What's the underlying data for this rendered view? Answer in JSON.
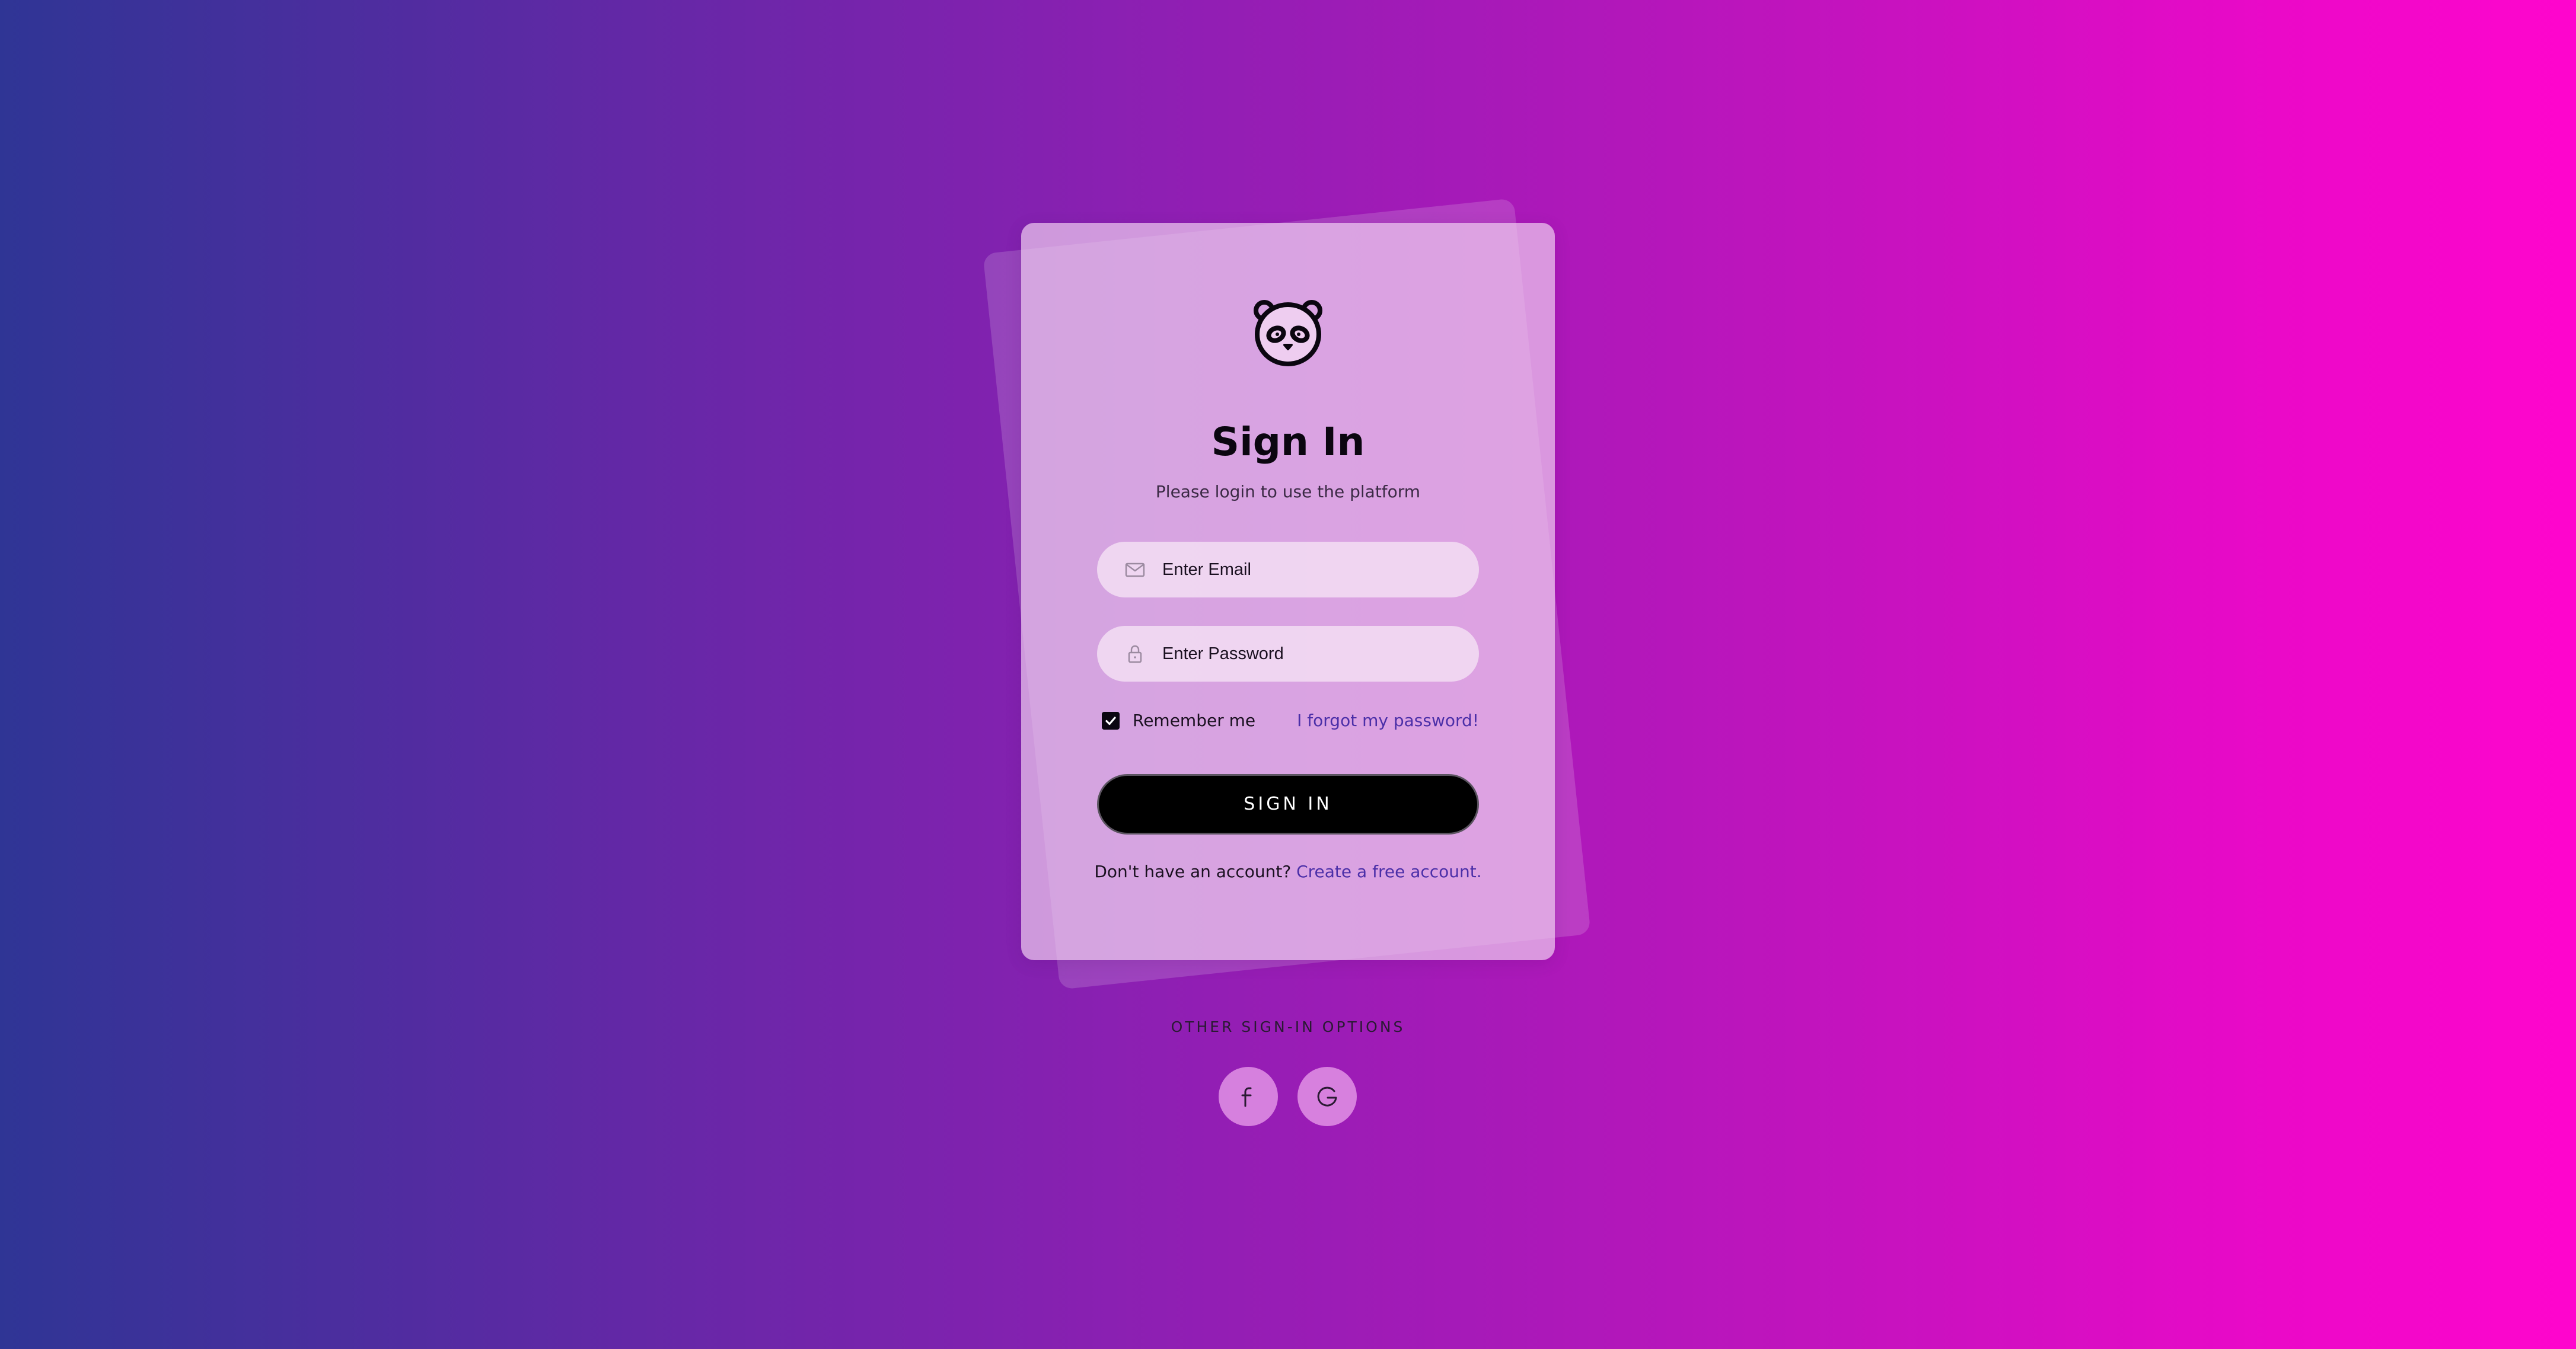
{
  "login_card": {
    "logo_icon": "panda-icon",
    "title": "Sign In",
    "subtitle": "Please login to use the platform",
    "email_field": {
      "icon": "mail-icon",
      "placeholder": "Enter Email",
      "value": ""
    },
    "password_field": {
      "icon": "lock-icon",
      "placeholder": "Enter Password",
      "value": ""
    },
    "remember_me": {
      "label": "Remember me",
      "checked": true
    },
    "forgot_password_link": "I forgot my password!",
    "sign_in_button": "SIGN IN",
    "signup_prompt": "Don't have an account?",
    "signup_link": "Create a free account."
  },
  "other_options": {
    "label": "OTHER SIGN-IN OPTIONS",
    "buttons": [
      {
        "icon": "facebook-icon"
      },
      {
        "icon": "google-icon"
      }
    ]
  },
  "colors": {
    "gradient_start": "#2f3595",
    "gradient_end": "#ff05cd",
    "accent_link": "#4b2fa8",
    "button_bg": "#000000"
  }
}
